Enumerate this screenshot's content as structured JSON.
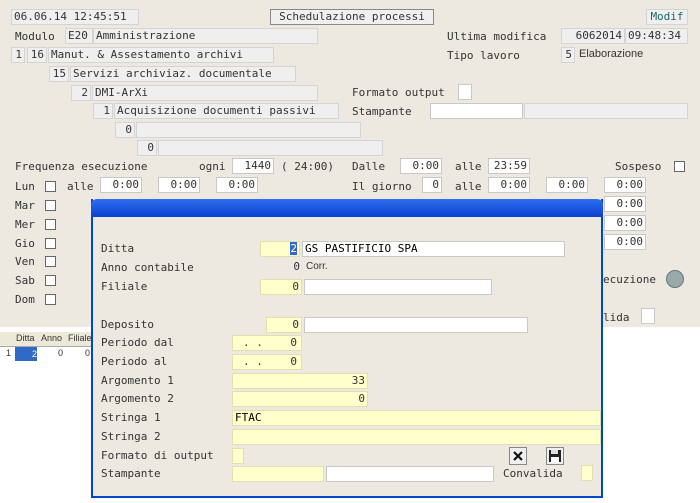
{
  "header": {
    "datetime": "06.06.14 12:45:51",
    "title_button": "Schedulazione processi",
    "modif_button": "Modif",
    "modulo_label": "Modulo",
    "modulo_code": "E20",
    "modulo_name": "Amministrazione",
    "ultima_label": "Ultima modifica",
    "ultima_date": "6062014",
    "ultima_time": "09:48:34",
    "tipo_label": "Tipo lavoro",
    "tipo_code": "5",
    "tipo_name": "Elaborazione"
  },
  "tree": {
    "l1_a": "1",
    "l1_b": "16",
    "l1_name": "Manut. & Assestamento archivi",
    "l2_num": "15",
    "l2_name": "Servizi archiviaz. documentale",
    "l3_num": "2",
    "l3_name": "DMI-ArXi",
    "l4_num": "1",
    "l4_name": "Acquisizione documenti passivi",
    "l5_num": "0",
    "l6_num": "0"
  },
  "output": {
    "formato_label": "Formato output",
    "stampante_label": "Stampante"
  },
  "schedule": {
    "frequenza_label": "Frequenza esecuzione",
    "ogni_label": "ogni",
    "ogni_value": "1440",
    "ogni_hours": "( 24:00)",
    "dalle_label": "Dalle",
    "dalle_value": "0:00",
    "alle_label": "alle",
    "alle_value": "23:59",
    "sospeso_label": "Sospeso",
    "ilgiorno_label": "Il giorno",
    "ilgiorno_value": "0",
    "ilgiorno_alle_value": "0:00",
    "days": [
      "Lun",
      "Mar",
      "Mer",
      "Gio",
      "Ven",
      "Sab",
      "Dom"
    ],
    "alle_short": "alle",
    "time_value": "0:00",
    "esecuzione_label": "ecuzione",
    "convalida_partial": "lida"
  },
  "grid": {
    "headers": [
      "Ditta",
      "Anno",
      "Filiale"
    ],
    "row": [
      "1",
      "2",
      "0",
      "0"
    ]
  },
  "dialog": {
    "ditta_label": "Ditta",
    "ditta_value": "2",
    "ditta_name": "GS PASTIFICIO SPA",
    "anno_label": "Anno contabile",
    "anno_value": "0",
    "anno_corr": "Corr.",
    "filiale_label": "Filiale",
    "filiale_value": "0",
    "deposito_label": "Deposito",
    "deposito_value": "0",
    "periodo_dal_label": "Periodo dal",
    "periodo_dal_date": ". .",
    "periodo_dal_value": "0",
    "periodo_al_label": "Periodo  al",
    "periodo_al_date": ". .",
    "periodo_al_value": "0",
    "arg1_label": "Argomento 1",
    "arg1_value": "33",
    "arg2_label": "Argomento 2",
    "arg2_value": "0",
    "str1_label": "Stringa  1",
    "str1_value": "FTAC",
    "str2_label": "Stringa  2",
    "formato_label": "Formato di output",
    "stampante_label": "Stampante",
    "convalida_label": "Convalida"
  },
  "colors": {
    "accent": "#0046cc",
    "field_yellow": "#ffffcc",
    "text": "#333333",
    "teal": "#1a6a6a"
  }
}
